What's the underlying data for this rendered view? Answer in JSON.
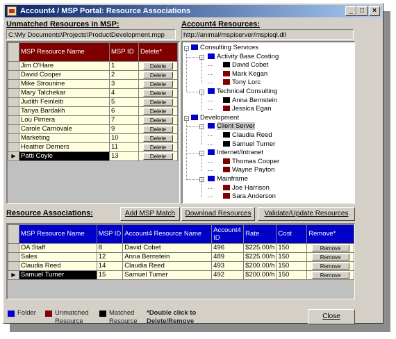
{
  "colors": {
    "folder": "#0000c8",
    "unmatched": "#800000",
    "matched": "#000000",
    "header_red": "#800000",
    "header_blue": "#0000c8",
    "cell": "#ffffe0"
  },
  "window": {
    "title": "Account4 / MSP Portal:  Resource Associations",
    "icon": "app-icon",
    "minimize": "_",
    "maximize": "□",
    "close": "×"
  },
  "unmatched": {
    "label": "Unmatched Resources in MSP:",
    "path": "C:\\My Documents\\Projects\\ProductDevelopment.mpp",
    "columns": [
      "MSP Resource Name",
      "MSP ID",
      "Delete*"
    ],
    "delete_label": "Delete",
    "rows": [
      {
        "name": "Jim O'Hare",
        "id": "1"
      },
      {
        "name": "David Cooper",
        "id": "2"
      },
      {
        "name": "Mike Strounine",
        "id": "3"
      },
      {
        "name": "Mary Talchekar",
        "id": "4"
      },
      {
        "name": "Judith Feinleib",
        "id": "5"
      },
      {
        "name": "Tanya Bardakh",
        "id": "6"
      },
      {
        "name": "Lou Pirriera",
        "id": "7"
      },
      {
        "name": "Carole Carnovale",
        "id": "9"
      },
      {
        "name": "Marketing",
        "id": "10"
      },
      {
        "name": "Heather Demers",
        "id": "11"
      },
      {
        "name": "Patti Coyle",
        "id": "13",
        "selected": true
      }
    ]
  },
  "account4": {
    "label": "Account4 Resources:",
    "url": "http://animal/mspiserver/mspisql.dll",
    "tree": [
      {
        "text": "Consulting Services",
        "type": "folder",
        "level": 0,
        "toggle": "-"
      },
      {
        "text": "Activity Base Costing",
        "type": "folder",
        "level": 1,
        "toggle": "-"
      },
      {
        "text": "David Cobet",
        "type": "matched",
        "level": 2
      },
      {
        "text": "Mark Kegan",
        "type": "unmatched",
        "level": 2
      },
      {
        "text": "Tony Lorc",
        "type": "unmatched",
        "level": 2
      },
      {
        "text": "Technical Consulting",
        "type": "folder",
        "level": 1,
        "toggle": "-"
      },
      {
        "text": "Anna Bernstein",
        "type": "matched",
        "level": 2
      },
      {
        "text": "Jessica Egan",
        "type": "unmatched",
        "level": 2
      },
      {
        "text": "Development",
        "type": "folder",
        "level": 0,
        "toggle": "-"
      },
      {
        "text": "Client Server",
        "type": "folder",
        "level": 1,
        "toggle": "-",
        "selected": true
      },
      {
        "text": "Claudia Reed",
        "type": "matched",
        "level": 2
      },
      {
        "text": "Samuel Turner",
        "type": "matched",
        "level": 2
      },
      {
        "text": "Internet/Intranet",
        "type": "folder",
        "level": 1,
        "toggle": "-"
      },
      {
        "text": "Thomas Cooper",
        "type": "unmatched",
        "level": 2
      },
      {
        "text": "Wayne Payton",
        "type": "unmatched",
        "level": 2
      },
      {
        "text": "Mainframe",
        "type": "folder",
        "level": 1,
        "toggle": "-"
      },
      {
        "text": "Joe Harrison",
        "type": "unmatched",
        "level": 2
      },
      {
        "text": "Sara Anderson",
        "type": "unmatched",
        "level": 2
      }
    ]
  },
  "associations": {
    "label": "Resource Associations:",
    "buttons": {
      "add": "Add MSP Match",
      "download": "Download Resources",
      "validate": "Validate/Update Resources"
    },
    "columns": [
      "MSP Resource Name",
      "MSP ID",
      "Account4 Resource Name",
      "Account4 ID",
      "Rate",
      "Cost",
      "Remove*"
    ],
    "remove_label": "Remove",
    "rows": [
      {
        "msp_name": "OA Staff",
        "msp_id": "8",
        "a4_name": "David Cobet",
        "a4_id": "496",
        "rate": "$225.00/h",
        "cost": "150"
      },
      {
        "msp_name": "Sales",
        "msp_id": "12",
        "a4_name": "Anna Bernstein",
        "a4_id": "489",
        "rate": "$225.00/h",
        "cost": "150"
      },
      {
        "msp_name": "Claudia Reed",
        "msp_id": "14",
        "a4_name": "Claudia Reed",
        "a4_id": "493",
        "rate": "$200.00/h",
        "cost": "150"
      },
      {
        "msp_name": "Samuel Turner",
        "msp_id": "15",
        "a4_name": "Samuel Turner",
        "a4_id": "492",
        "rate": "$200.00/h",
        "cost": "150",
        "selected": true
      }
    ]
  },
  "legend": {
    "folder": "Folder",
    "unmatched_1": "Unmatched",
    "unmatched_2": "Resource",
    "matched_1": "Matched",
    "matched_2": "Resource",
    "note_1": "*Double click to",
    "note_2": "Delete/Remove"
  },
  "close_button": "Close",
  "row_pointer": "▶"
}
